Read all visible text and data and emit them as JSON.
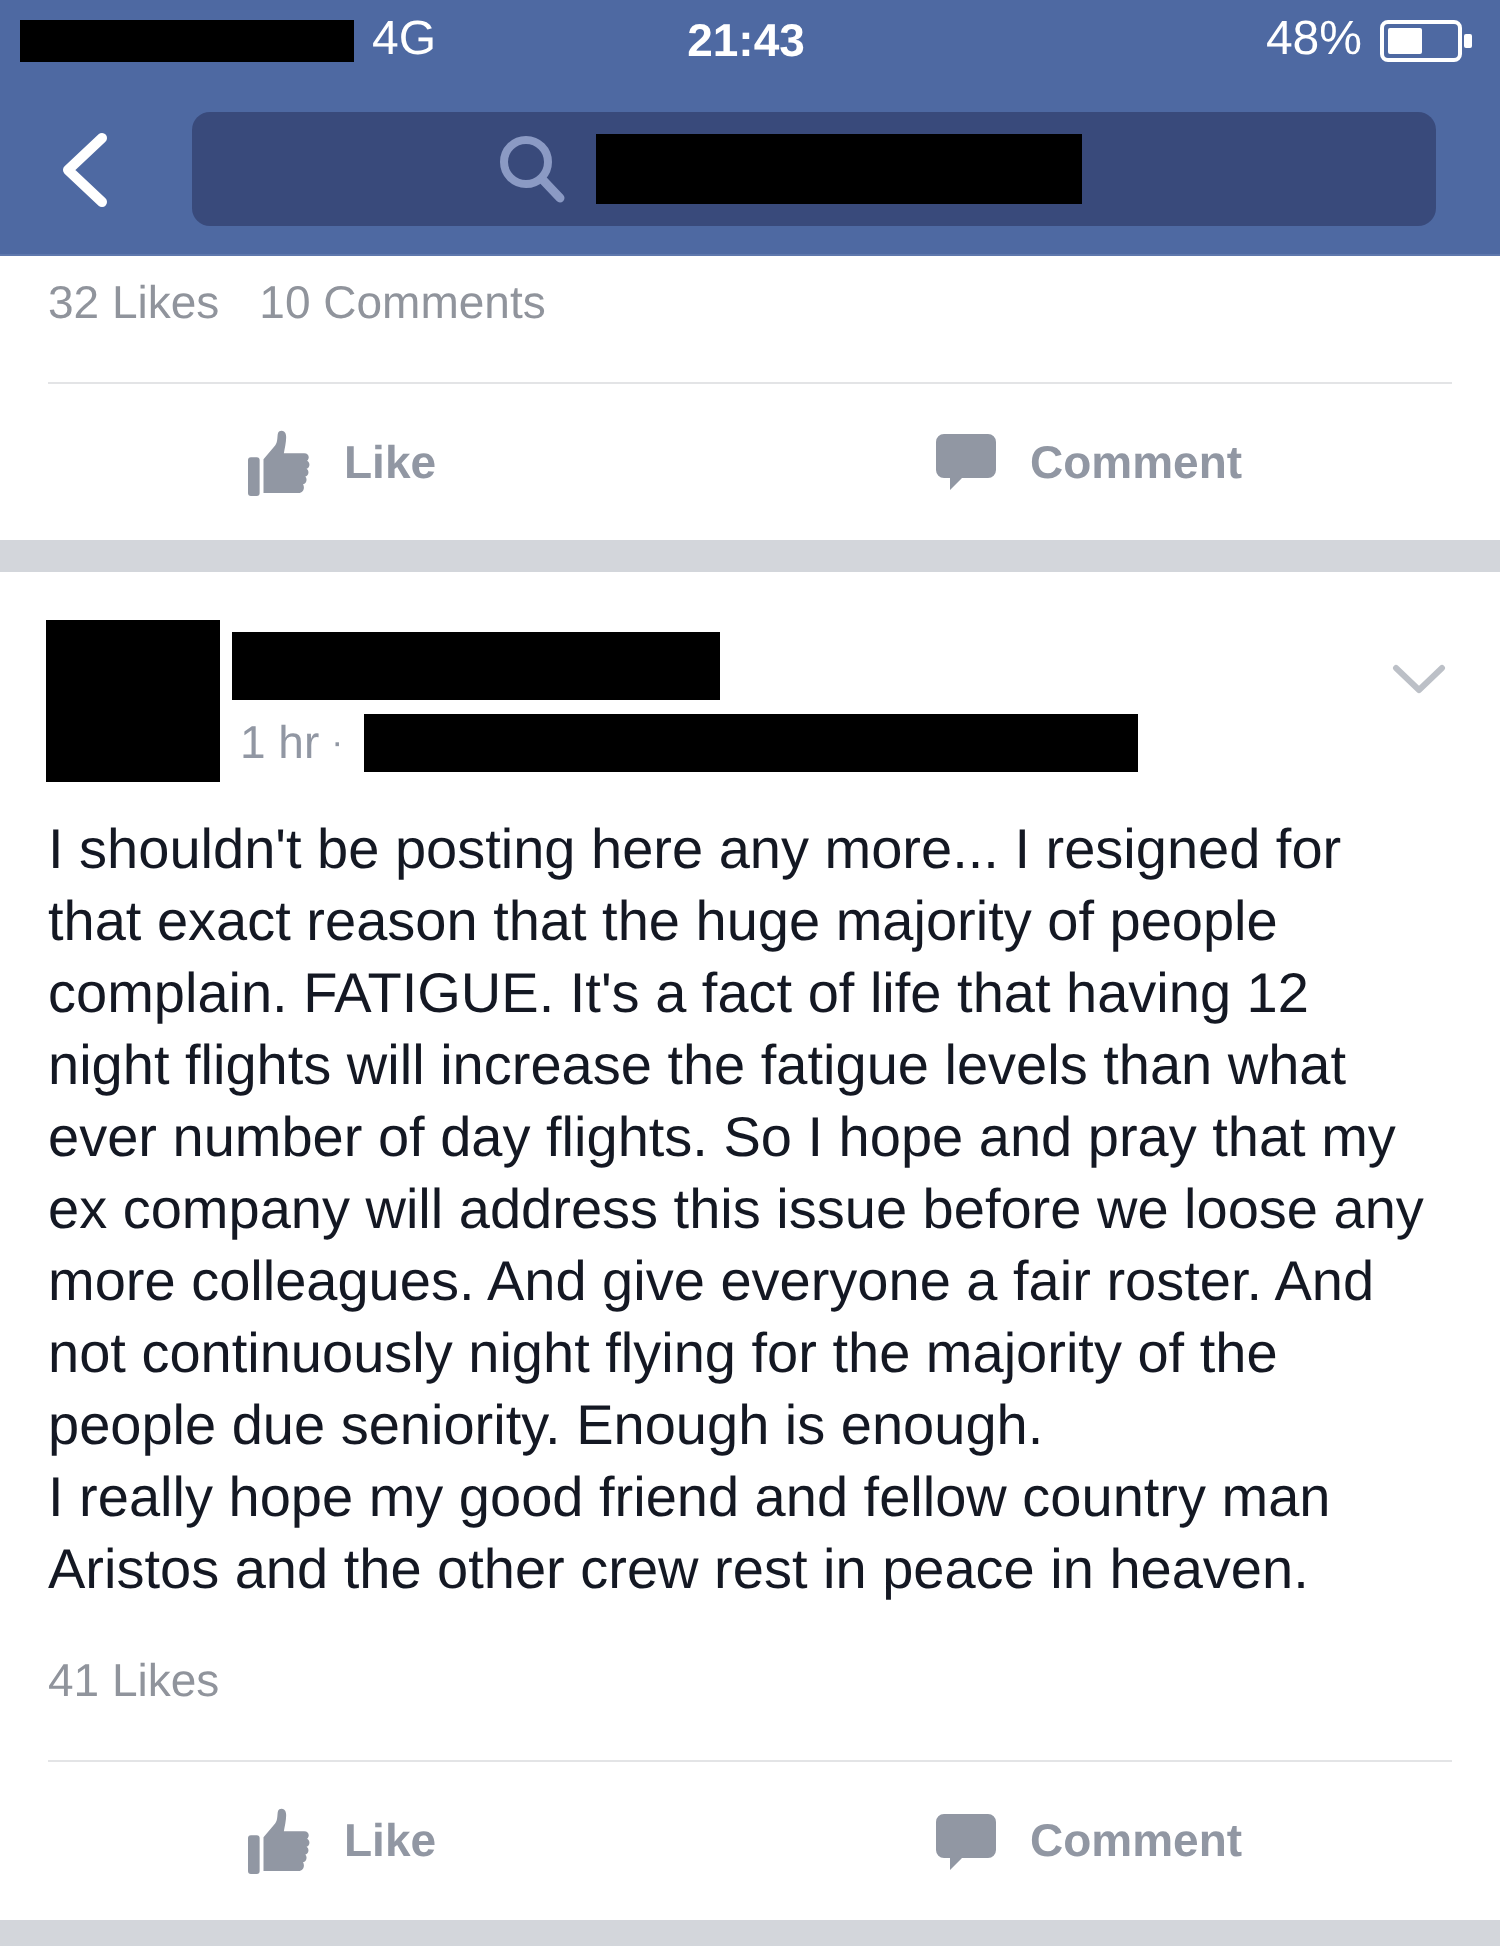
{
  "status_bar": {
    "network": "4G",
    "time": "21:43",
    "battery": "48%"
  },
  "posts": [
    {
      "stats": [
        "32 Likes",
        "10 Comments"
      ],
      "actions": [
        {
          "kind": "like",
          "label": "Like"
        },
        {
          "kind": "comment",
          "label": "Comment"
        }
      ]
    },
    {
      "time": "1 hr",
      "separator": "·",
      "body": [
        "I shouldn't be posting here any more... I resigned for that exact reason that the huge majority of people complain. FATIGUE. It's a fact of life that having 12 night flights will increase the fatigue levels than what ever number of day flights. So I hope and pray that my ex company will address this issue before we loose any more colleagues. And give everyone a fair roster. And not continuously night flying for the majority of the people due seniority. Enough is enough.",
        "I really hope my good friend and fellow country man Aristos and the other crew rest in peace in heaven."
      ],
      "stats": [
        "41 Likes"
      ],
      "actions": [
        {
          "kind": "like",
          "label": "Like"
        },
        {
          "kind": "comment",
          "label": "Comment"
        }
      ]
    }
  ]
}
